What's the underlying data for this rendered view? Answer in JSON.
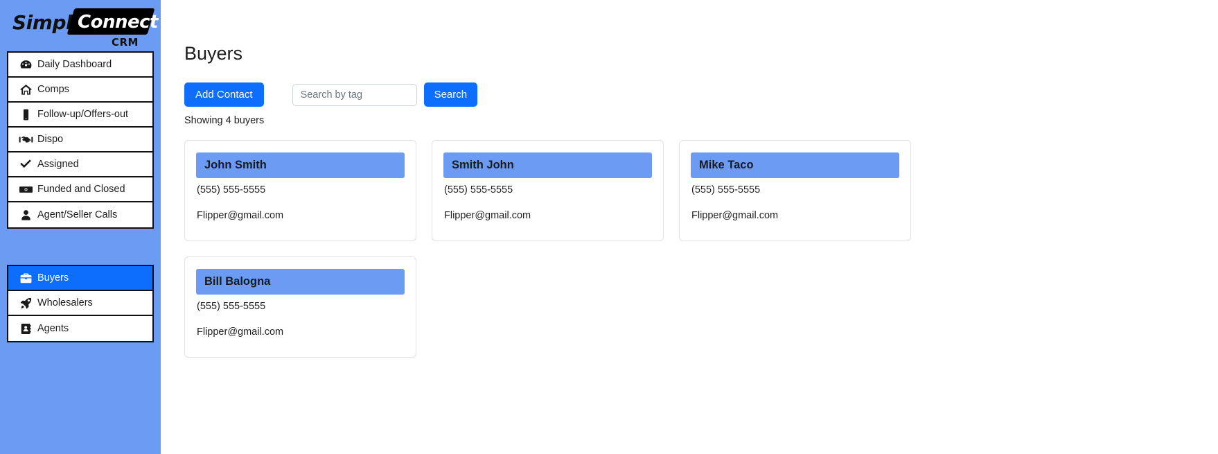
{
  "brand": {
    "word_one": "Simple",
    "word_two": "Connect",
    "subtitle": "CRM"
  },
  "sidebar": {
    "group_one": [
      {
        "label": "Daily Dashboard",
        "icon": "gauge-icon",
        "active": false
      },
      {
        "label": "Comps",
        "icon": "house-icon",
        "active": false
      },
      {
        "label": "Follow-up/Offers-out",
        "icon": "mobile-phone-icon",
        "active": false
      },
      {
        "label": "Dispo",
        "icon": "handshake-icon",
        "active": false
      },
      {
        "label": "Assigned",
        "icon": "check-icon",
        "active": false
      },
      {
        "label": "Funded and Closed",
        "icon": "money-bill-icon",
        "active": false
      },
      {
        "label": "Agent/Seller Calls",
        "icon": "user-icon",
        "active": false
      }
    ],
    "group_two": [
      {
        "label": "Buyers",
        "icon": "briefcase-icon",
        "active": true
      },
      {
        "label": "Wholesalers",
        "icon": "rocket-icon",
        "active": false
      },
      {
        "label": "Agents",
        "icon": "address-book-icon",
        "active": false
      }
    ]
  },
  "main": {
    "title": "Buyers",
    "add_contact_label": "Add Contact",
    "search_placeholder": "Search by tag",
    "search_value": "",
    "search_button_label": "Search",
    "showing_text": "Showing 4 buyers",
    "cards": [
      {
        "name": "John Smith",
        "phone": "(555) 555-5555",
        "email": "Flipper@gmail.com"
      },
      {
        "name": "Smith John",
        "phone": "(555) 555-5555",
        "email": "Flipper@gmail.com"
      },
      {
        "name": "Mike Taco",
        "phone": "(555) 555-5555",
        "email": "Flipper@gmail.com"
      },
      {
        "name": "Bill Balogna",
        "phone": "(555) 555-5555",
        "email": "Flipper@gmail.com"
      }
    ]
  },
  "colors": {
    "sidebar_blue": "#6b9bf2",
    "accent_blue": "#0d6efd",
    "card_header_blue": "#6b9bf2",
    "text_dark": "#1f1f1f"
  }
}
